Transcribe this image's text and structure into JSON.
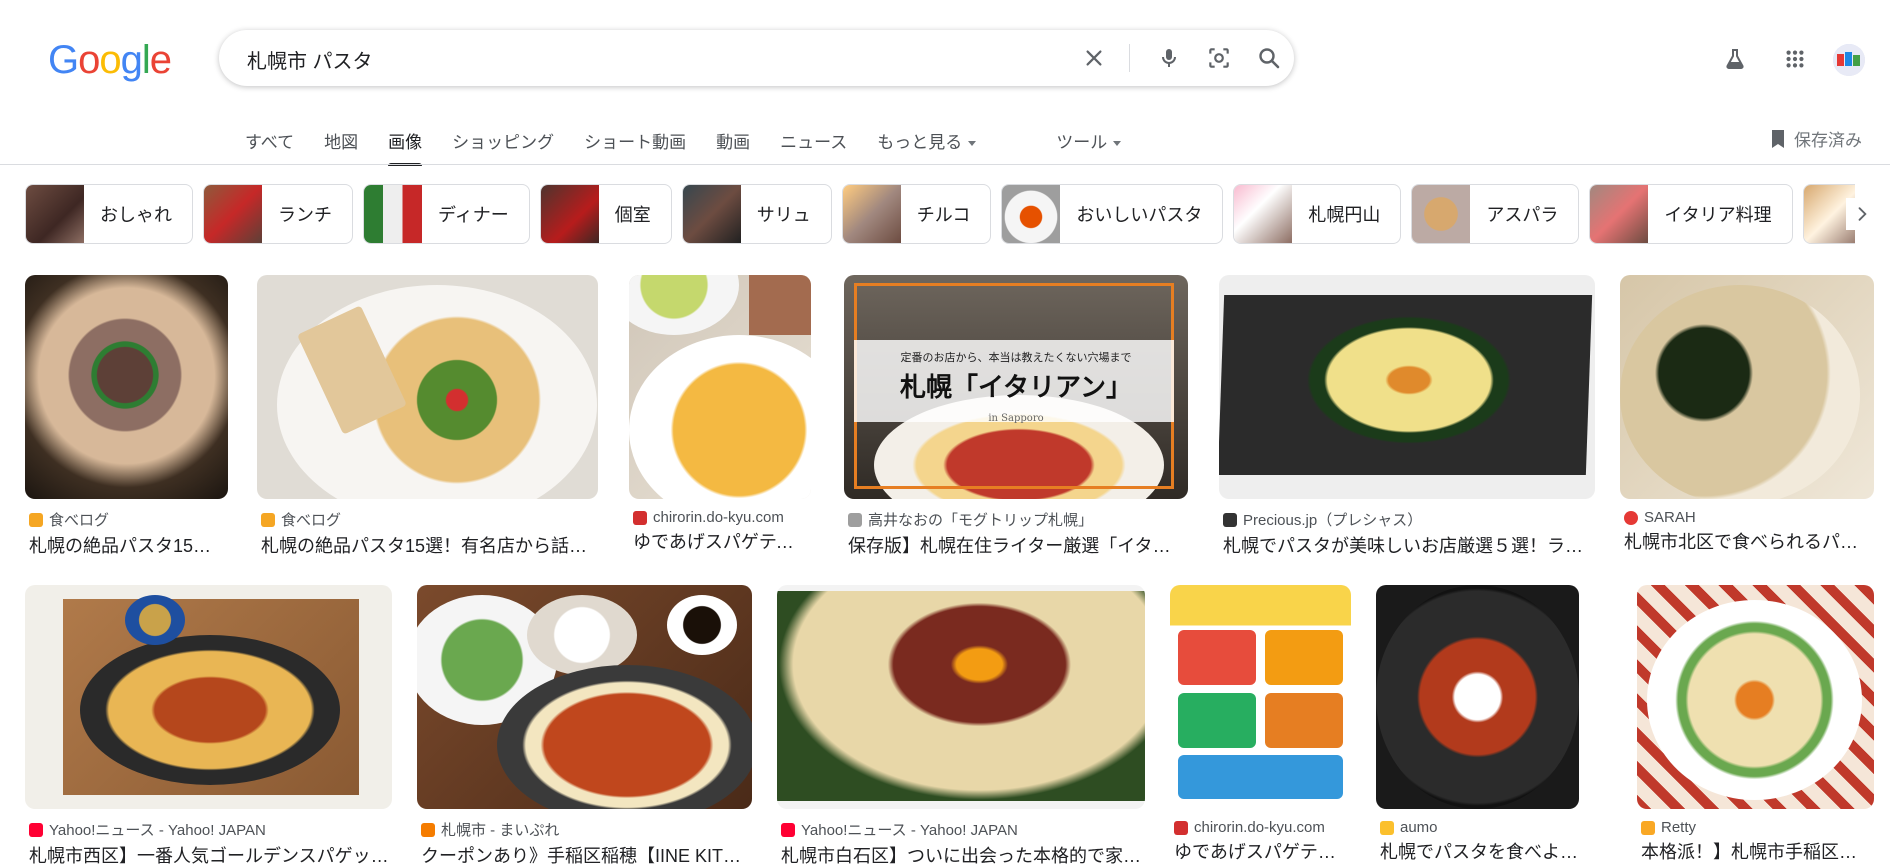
{
  "search": {
    "query": "札幌市 パスタ"
  },
  "header": {
    "logo": [
      "G",
      "o",
      "o",
      "g",
      "l",
      "e"
    ],
    "logo_colors": [
      "#4285F4",
      "#EA4335",
      "#FBBC05",
      "#4285F4",
      "#34A853",
      "#EA4335"
    ],
    "icons": {
      "clear": "close-icon",
      "voice": "microphone-icon",
      "lens": "camera-lens-icon",
      "search": "search-icon",
      "labs": "flask-icon",
      "apps": "apps-grid-icon",
      "avatar": "avatar"
    }
  },
  "tabs": [
    {
      "label": "すべて",
      "active": false
    },
    {
      "label": "地図",
      "active": false
    },
    {
      "label": "画像",
      "active": true
    },
    {
      "label": "ショッピング",
      "active": false
    },
    {
      "label": "ショート動画",
      "active": false
    },
    {
      "label": "動画",
      "active": false
    },
    {
      "label": "ニュース",
      "active": false
    },
    {
      "label": "もっと見る",
      "active": false
    },
    {
      "label": "ツール",
      "active": false
    }
  ],
  "saved_label": "保存済み",
  "chips": [
    {
      "label": "おしゃれ"
    },
    {
      "label": "ランチ"
    },
    {
      "label": "ディナー"
    },
    {
      "label": "個室"
    },
    {
      "label": "サリュ"
    },
    {
      "label": "チルコ"
    },
    {
      "label": "おいしいパスタ"
    },
    {
      "label": "札幌円山"
    },
    {
      "label": "アスパラ"
    },
    {
      "label": "イタリア料理"
    }
  ],
  "results_row1": [
    {
      "source": "食べログ",
      "title": "札幌の絶品パスタ15…",
      "fav_color": "#f5a623"
    },
    {
      "source": "食べログ",
      "title": "札幌の絶品パスタ15選！有名店から話…",
      "fav_color": "#f5a623"
    },
    {
      "source": "chirorin.do-kyu.com",
      "title": "ゆであげスパゲティ…",
      "fav_color": "#d32f2f"
    },
    {
      "source": "高井なおの「モグトリップ札幌」",
      "title": "保存版】札幌在住ライター厳選「イタリ…",
      "fav_color": "#9e9e9e",
      "overlay_top": "定番のお店から、本当は教えたくない穴場まで",
      "overlay_main": "札幌「イタリアン」",
      "overlay_sub": "in Sapporo"
    },
    {
      "source": "Precious.jp（プレシャス）",
      "title": "札幌でパスタが美味しいお店厳選５選！ラ…",
      "fav_color": "#333333"
    },
    {
      "source": "SARAH",
      "title": "札幌市北区で食べられるパ…",
      "fav_color": "#e53935"
    }
  ],
  "results_row2": [
    {
      "source": "Yahoo!ニュース - Yahoo! JAPAN",
      "title": "札幌市西区】一番人気ゴールデンスパゲッ…",
      "fav_color": "#ff0033"
    },
    {
      "source": "札幌市 - まいぷれ",
      "title": "クーポンあり》手稲区稲穂【IINE KIT…",
      "fav_color": "#f57c00"
    },
    {
      "source": "Yahoo!ニュース - Yahoo! JAPAN",
      "title": "札幌市白石区】ついに出会った本格的で家…",
      "fav_color": "#ff0033"
    },
    {
      "source": "chirorin.do-kyu.com",
      "title": "ゆであげスパゲテ…",
      "fav_color": "#d32f2f"
    },
    {
      "source": "aumo",
      "title": "札幌でパスタを食べよう♪…",
      "fav_color": "#fbc02d"
    },
    {
      "source": "Retty",
      "title": "本格派！】札幌市手稲区…",
      "fav_color": "#f9a825"
    }
  ]
}
